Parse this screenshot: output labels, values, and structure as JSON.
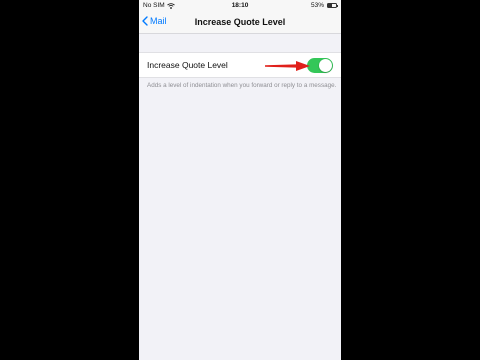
{
  "status_bar": {
    "carrier": "No SIM",
    "time": "18:10",
    "battery_percent": "53%",
    "battery_level": 0.53
  },
  "nav": {
    "back_label": "Mail",
    "title": "Increase Quote Level"
  },
  "setting": {
    "label": "Increase Quote Level",
    "toggle_on": true,
    "description": "Adds a level of indentation when you forward or reply to a message."
  },
  "colors": {
    "accent": "#007aff",
    "toggle_on": "#34c759",
    "annotation_arrow": "#e0201b"
  },
  "icons": [
    "wifi-icon",
    "back-chevron-icon",
    "battery-icon",
    "annotation-arrow-icon"
  ]
}
